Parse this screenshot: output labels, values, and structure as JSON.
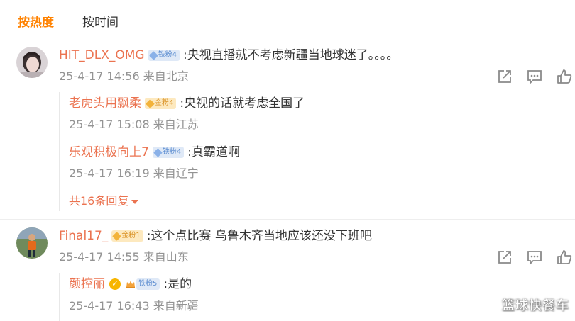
{
  "tabs": [
    {
      "label": "按热度",
      "active": true
    },
    {
      "label": "按时间",
      "active": false
    }
  ],
  "colors": {
    "accent": "#ff8200",
    "username": "#eb7350",
    "meta": "#939393"
  },
  "comments": [
    {
      "username": "HIT_DLX_OMG",
      "badge": "铁粉4",
      "badge_type": "iron",
      "text": ":央视直播就不考虑新疆当地球迷了。。。。",
      "time": "25-4-17 14:56",
      "location": "来自北京",
      "avatar_icon": "user-avatar-photo",
      "replies": [
        {
          "username": "老虎头用飘柔",
          "badge": "金粉4",
          "badge_type": "gold",
          "text": ":央视的话就考虑全国了",
          "time": "25-4-17 15:08",
          "location": "来自江苏"
        },
        {
          "username": "乐观积极向上7",
          "badge": "铁粉4",
          "badge_type": "iron",
          "text": ":真霸道啊",
          "time": "25-4-17 16:19",
          "location": "来自辽宁"
        }
      ],
      "more_replies": "共16条回复"
    },
    {
      "username": "Final17_",
      "badge": "金粉1",
      "badge_type": "gold",
      "text": ":这个点比赛 乌鲁木齐当地应该还没下班吧",
      "time": "25-4-17 14:55",
      "location": "来自山东",
      "avatar_icon": "user-avatar-soccer",
      "replies": [
        {
          "username": "颜控丽",
          "badge": "铁粉5",
          "badge_type": "iron",
          "text": ":是的",
          "time": "25-4-17 16:43",
          "location": "来自新疆",
          "verified": true
        }
      ]
    }
  ],
  "icons": {
    "share": "share-icon",
    "comment": "comment-icon",
    "like": "like-icon"
  },
  "watermark": "篮球快餐车"
}
